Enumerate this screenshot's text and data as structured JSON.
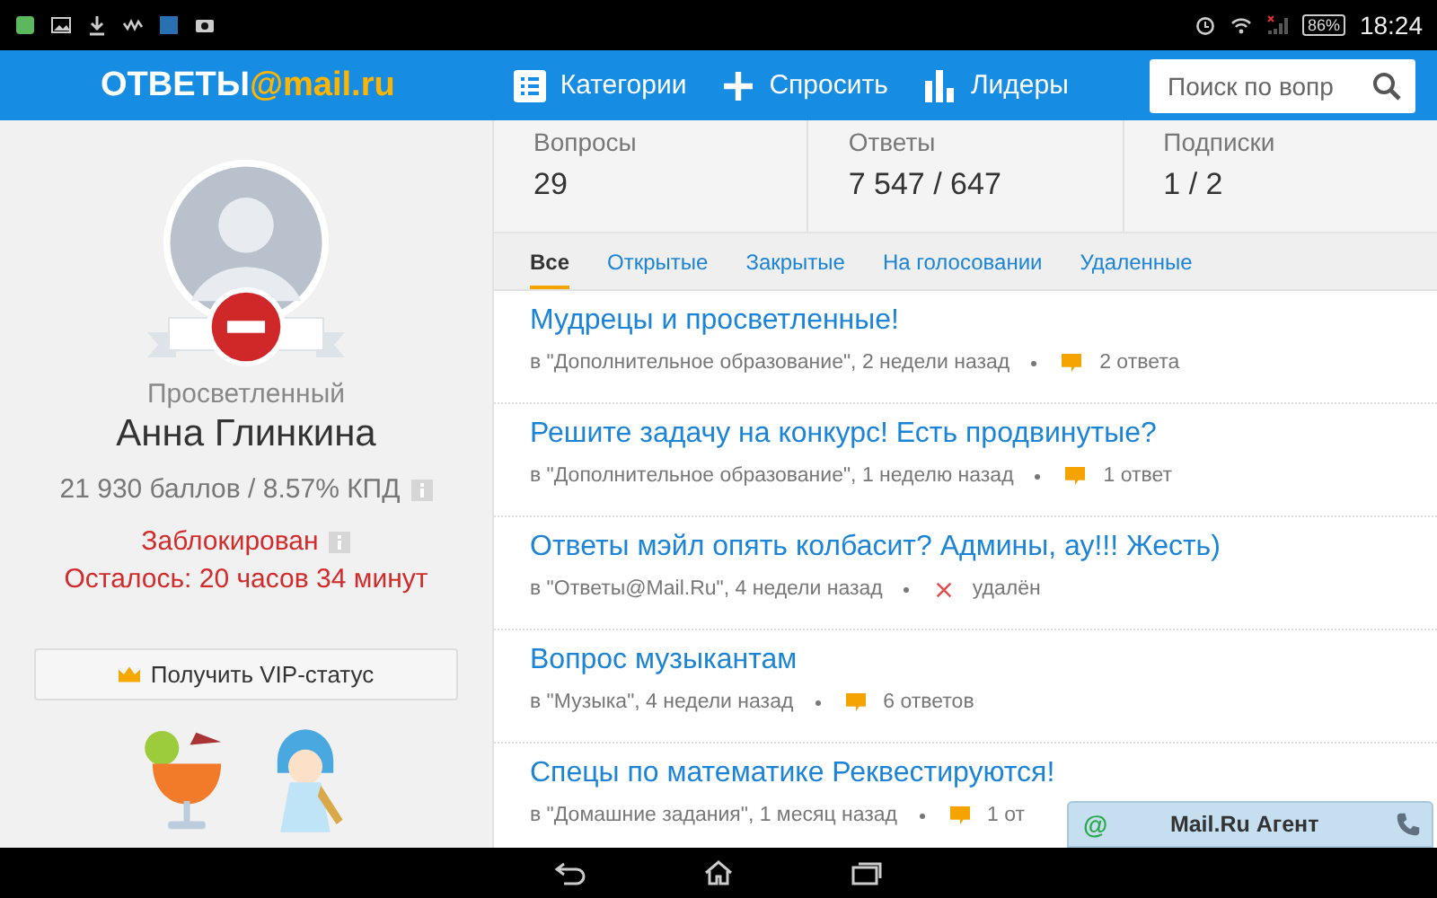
{
  "status_bar": {
    "battery": "86%",
    "time": "18:24"
  },
  "header": {
    "logo_main": "ОТВЕТЫ",
    "logo_accent": "@mail.ru",
    "nav": [
      {
        "label": "Категории",
        "kind": "list"
      },
      {
        "label": "Спросить",
        "kind": "plus"
      },
      {
        "label": "Лидеры",
        "kind": "bars"
      }
    ],
    "search": {
      "placeholder": "Поиск по вопр"
    }
  },
  "profile": {
    "rank": "Просветленный",
    "name": "Анна Глинкина",
    "score": "21 930 баллов / 8.57% КПД",
    "blocked": true,
    "blocked_label": "Заблокирован",
    "remaining": "Осталось: 20 часов 34 минут",
    "vip_button": "Получить VIP-статус"
  },
  "stats": [
    {
      "label": "Вопросы",
      "value": "29"
    },
    {
      "label": "Ответы",
      "value": "7 547 / 647"
    },
    {
      "label": "Подписки",
      "value": "1 / 2"
    }
  ],
  "tabs": [
    {
      "label": "Все",
      "selected": true
    },
    {
      "label": "Открытые",
      "selected": false
    },
    {
      "label": "Закрытые",
      "selected": false
    },
    {
      "label": "На голосовании",
      "selected": false
    },
    {
      "label": "Удаленные",
      "selected": false
    }
  ],
  "questions": [
    {
      "title": "Мудрецы и просветленные!",
      "meta": "в \"Дополнительное образование\", 2 недели назад",
      "kind": "answers",
      "status": "2 ответа"
    },
    {
      "title": "Решите задачу на конкурс! Есть продвинутые?",
      "meta": "в \"Дополнительное образование\", 1 неделю назад",
      "kind": "answers",
      "status": "1 ответ"
    },
    {
      "title": "Ответы мэйл опять колбасит? Админы, ау!!! Жесть)",
      "meta": "в \"Ответы@Mail.Ru\", 4 недели назад",
      "kind": "deleted",
      "status": "удалён"
    },
    {
      "title": "Вопрос музыкантам",
      "meta": "в \"Музыка\", 4 недели назад",
      "kind": "answers",
      "status": "6 ответов"
    },
    {
      "title": "Спецы по математике Реквестируются!",
      "meta": "в \"Домашние задания\", 1 месяц назад",
      "kind": "answers",
      "status": "1 от"
    }
  ],
  "agent": {
    "at_sign": "@",
    "title": "Mail.Ru Агент"
  }
}
